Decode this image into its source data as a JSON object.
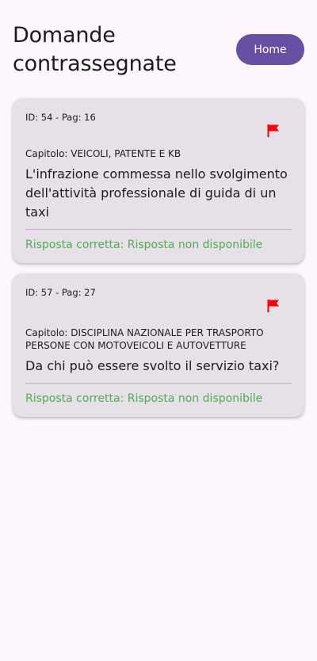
{
  "header": {
    "title": "Domande contrassegnate",
    "home_label": "Home"
  },
  "colors": {
    "accent": "#6750a4",
    "background": "#fdf6fd",
    "card_background": "#e7e0e8",
    "flag": "#ff0000",
    "answer_text": "#4caf50"
  },
  "questions": [
    {
      "meta": "ID: 54 - Pag: 16",
      "chapter": "Capitolo: VEICOLI, PATENTE E KB",
      "text": "L'infrazione commessa nello svolgimento dell'attività professionale di guida di un taxi",
      "answer": "Risposta corretta: Risposta non disponibile",
      "flag_icon": "flag-icon"
    },
    {
      "meta": "ID: 57 - Pag: 27",
      "chapter": "Capitolo: DISCIPLINA NAZIONALE PER TRASPORTO PERSONE CON MOTOVEICOLI E AUTOVETTURE",
      "text": "Da chi può essere svolto il servizio taxi?",
      "answer": "Risposta corretta: Risposta non disponibile",
      "flag_icon": "flag-icon"
    }
  ]
}
